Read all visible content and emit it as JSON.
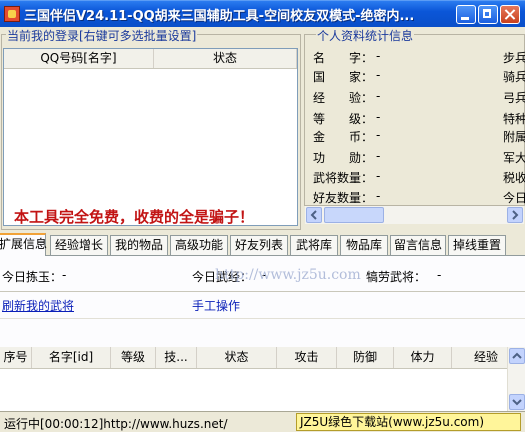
{
  "window": {
    "title": "三国伴侣V24.11-QQ胡来三国辅助工具-空间校友双模式-绝密内..."
  },
  "login_panel": {
    "legend": "当前我的登录[右键可多选批量设置]",
    "columns": [
      "QQ号码[名字]",
      "状态"
    ]
  },
  "profile_panel": {
    "legend": "个人资料统计信息",
    "rows": [
      {
        "label": "名　　字：",
        "value": "-"
      },
      {
        "label": "国　　家：",
        "value": "-"
      },
      {
        "label": "经　　验：",
        "value": "-"
      },
      {
        "label": "等　　级：",
        "value": "-"
      },
      {
        "label": "金　　币：",
        "value": "-"
      },
      {
        "label": "功　　勋：",
        "value": "-"
      },
      {
        "label": "武将数量：",
        "value": "-"
      },
      {
        "label": "好友数量：",
        "value": "-"
      }
    ],
    "right_column": [
      "步兵",
      "骑兵",
      "弓兵",
      "特种",
      "附属",
      "军大",
      "税收",
      "今日"
    ]
  },
  "notice": "本工具完全免费，收费的全是骗子！",
  "tabs": [
    {
      "label": "扩展信息",
      "active": true
    },
    {
      "label": "经验增长",
      "active": false
    },
    {
      "label": "我的物品",
      "active": false
    },
    {
      "label": "高级功能",
      "active": false
    },
    {
      "label": "好友列表",
      "active": false
    },
    {
      "label": "武将库",
      "active": false
    },
    {
      "label": "物品库",
      "active": false
    },
    {
      "label": "留言信息",
      "active": false
    },
    {
      "label": "掉线重置",
      "active": false
    }
  ],
  "extended_info": {
    "stats": [
      {
        "label": "今日拣玉：",
        "value": "-"
      },
      {
        "label": "今日武经：",
        "value": "-"
      },
      {
        "label": "犒劳武将：",
        "value": "-"
      }
    ],
    "refresh_link": "刷新我的武将",
    "manual_link": "手工操作",
    "watermark": "http://www.jz5u.com",
    "columns": [
      "序号",
      "名字[id]",
      "等级",
      "技...",
      "状态",
      "攻击",
      "防御",
      "体力",
      "经验"
    ]
  },
  "statusbar": {
    "status": "运行中[00:00:12]http://www.huzs.net/",
    "brand": "JZ5U绿色下载站(www.jz5u.com)"
  },
  "colors": {
    "titlebar": "#0a4fc9",
    "legend": "#1b3a9c",
    "notice": "#c21414",
    "link": "#0a1fb8",
    "active_tab_top": "#f1a237"
  }
}
